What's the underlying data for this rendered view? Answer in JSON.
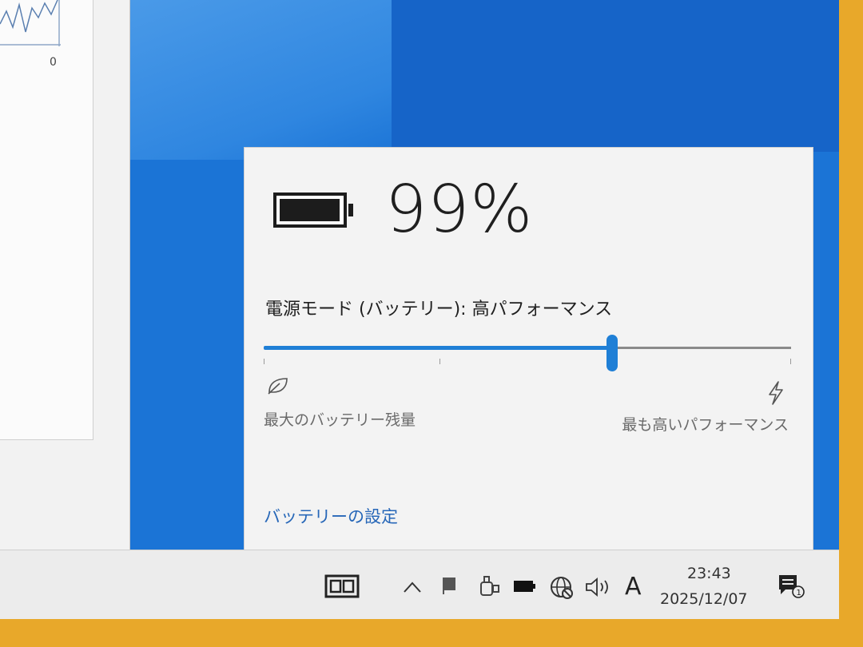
{
  "background_window": {
    "graph_axis_label": "0"
  },
  "battery": {
    "percent_text": "99%",
    "level_fraction": 0.99
  },
  "power_mode": {
    "label": "電源モード (バッテリー): 高パフォーマンス",
    "slider_fraction": 0.66,
    "min_label": "最大のバッテリー残量",
    "max_label": "最も高いパフォーマンス"
  },
  "settings_link": "バッテリーの設定",
  "taskbar": {
    "ime_indicator": "A",
    "time": "23:43",
    "date": "2025/12/07",
    "tray_icons": [
      "chevron-up-icon",
      "flag-icon",
      "usb-device-icon",
      "battery-icon",
      "network-globe-icon",
      "speaker-icon"
    ]
  },
  "colors": {
    "accent": "#1f7fd6",
    "desktop": "#1b74d6",
    "link": "#2767b8",
    "flyout_bg": "#f3f3f3"
  }
}
